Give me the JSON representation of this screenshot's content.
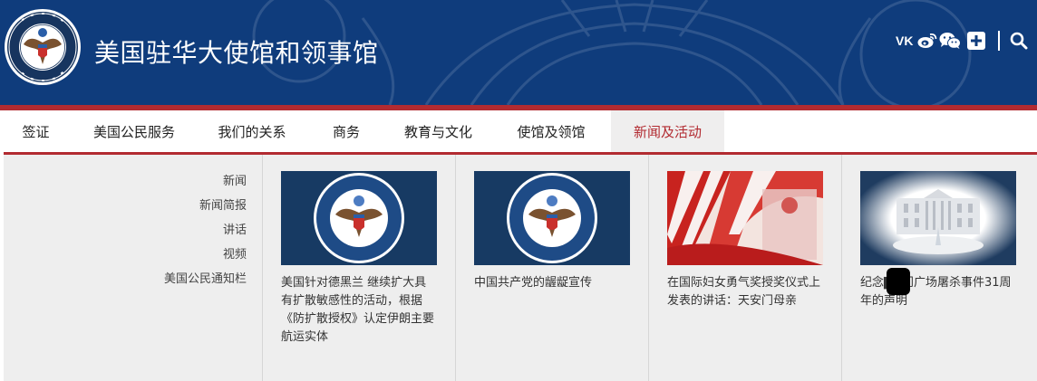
{
  "site": {
    "title": "美国驻华大使馆和领事馆",
    "colors": {
      "header_blue": "#0f3c7c",
      "accent_red": "#b22b31",
      "menu_bg": "#eeeeee"
    }
  },
  "utility": {
    "icons": [
      "vk-icon",
      "weibo-icon",
      "wechat-icon",
      "plus-icon",
      "search-icon"
    ],
    "vk_label": "VK"
  },
  "nav": {
    "items": [
      {
        "label": "签证",
        "active": false
      },
      {
        "label": "美国公民服务",
        "active": false
      },
      {
        "label": "我们的关系",
        "active": false
      },
      {
        "label": "商务",
        "active": false
      },
      {
        "label": "教育与文化",
        "active": false
      },
      {
        "label": "使馆及领馆",
        "active": false
      },
      {
        "label": "新闻及活动",
        "active": true
      }
    ]
  },
  "submenu": {
    "items": [
      "新闻",
      "新闻简报",
      "讲话",
      "视频",
      "美国公民通知栏"
    ]
  },
  "cards": [
    {
      "title": "美国针对德黑兰 继续扩大具有扩散敏感性的活动，根据《防扩散授权》认定伊朗主要航运实体",
      "image": "state-department-seal"
    },
    {
      "title": "中国共产党的龌龊宣传",
      "image": "state-department-seal"
    },
    {
      "title": "在国际妇女勇气奖授奖仪式上发表的讲话：天安门母亲",
      "image": "award-ceremony-flags"
    },
    {
      "title": "纪念▇▇门广场屠杀事件31周年的声明",
      "image": "white-house"
    }
  ]
}
